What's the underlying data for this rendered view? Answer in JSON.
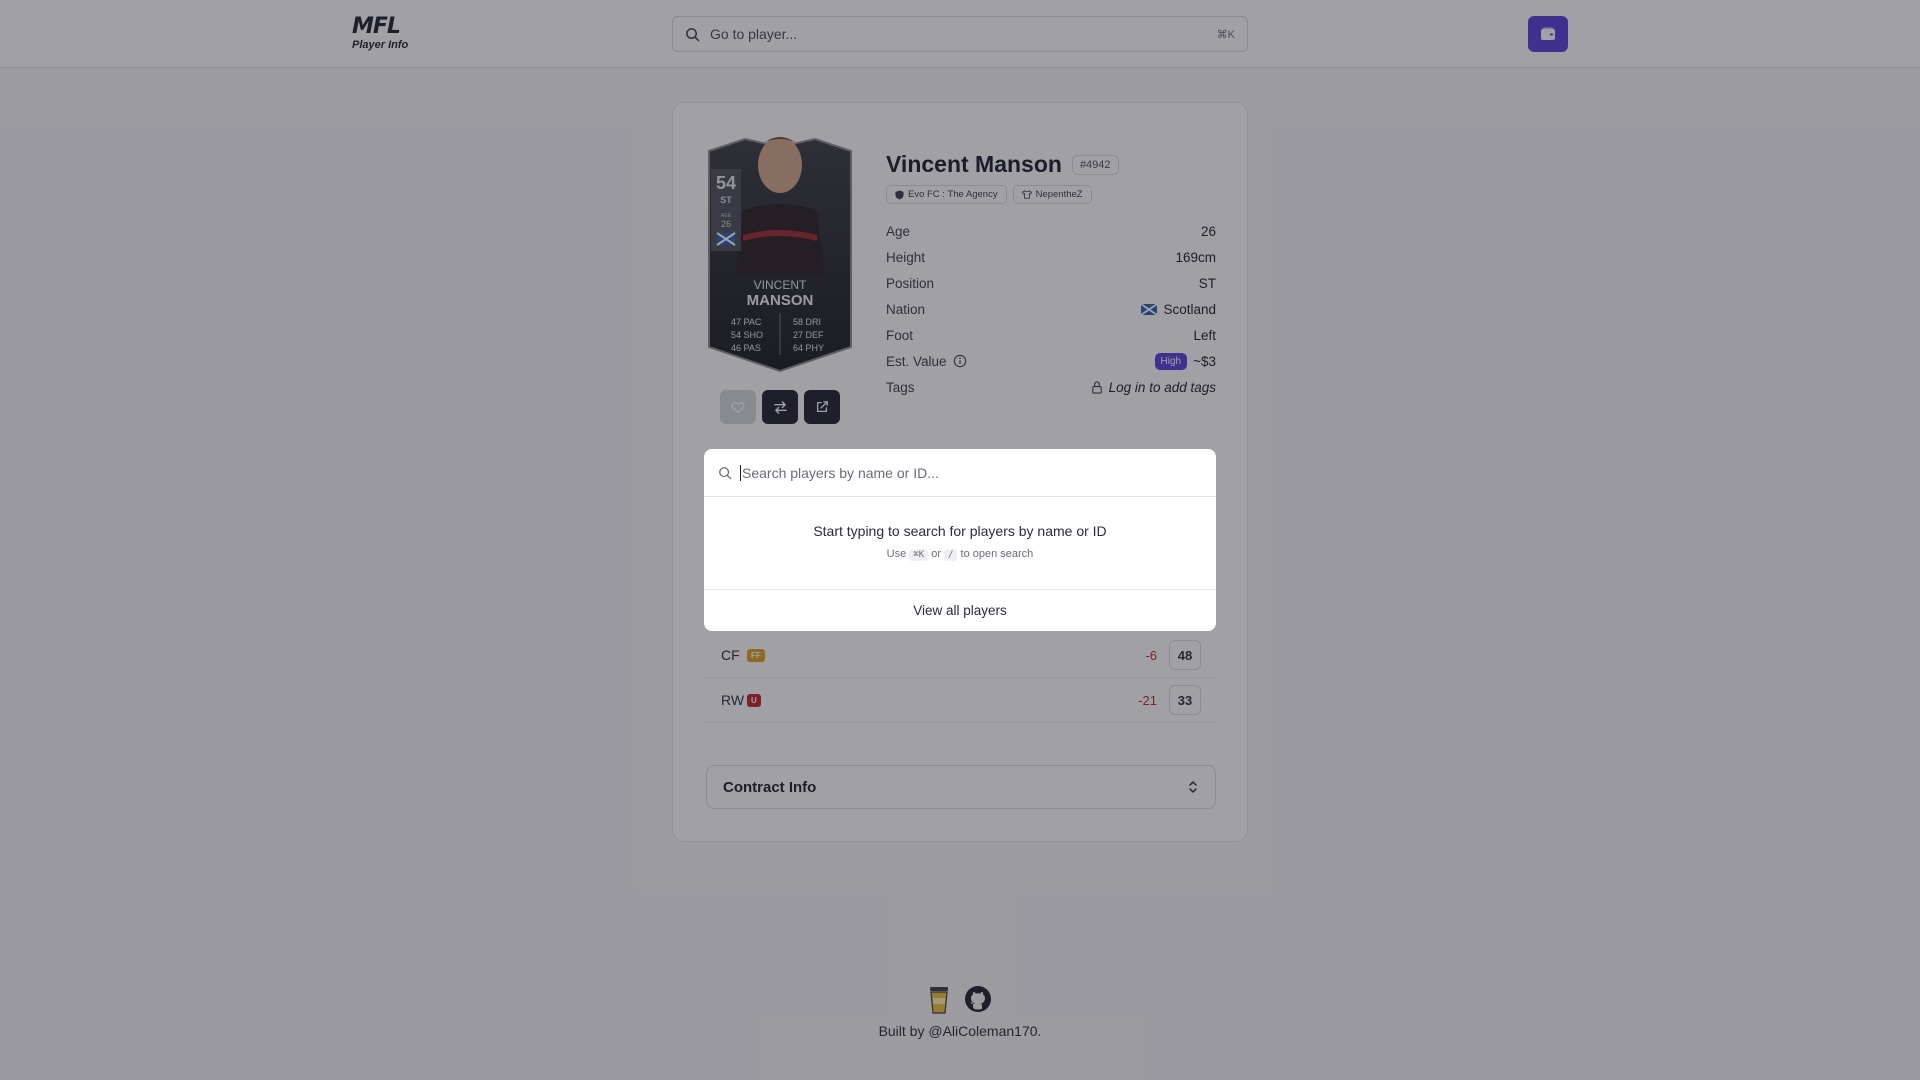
{
  "header": {
    "logo_text": "MFL",
    "logo_sub": "Player Info",
    "search_placeholder": "Go to player...",
    "search_shortcut": "⌘K"
  },
  "player": {
    "name": "Vincent Manson",
    "id": "#4942",
    "club": "Evo FC : The Agency",
    "owner": "NepentheZ",
    "attributes": [
      {
        "label": "Age",
        "value": "26"
      },
      {
        "label": "Height",
        "value": "169cm"
      },
      {
        "label": "Position",
        "value": "ST"
      },
      {
        "label": "Nation",
        "value": "Scotland"
      },
      {
        "label": "Foot",
        "value": "Left"
      },
      {
        "label": "Est. Value",
        "badge": "High",
        "value": "~$3"
      },
      {
        "label": "Tags",
        "value": "Log in to add tags"
      }
    ]
  },
  "card": {
    "overall": "54",
    "position": "ST",
    "age_label": "AGE",
    "age": "26",
    "first_name": "VINCENT",
    "last_name": "MANSON",
    "stats_left": [
      {
        "value": "47",
        "label": "PAC"
      },
      {
        "value": "54",
        "label": "SHO"
      },
      {
        "value": "46",
        "label": "PAS"
      }
    ],
    "stats_right": [
      {
        "value": "58",
        "label": "DRI"
      },
      {
        "value": "27",
        "label": "DEF"
      },
      {
        "value": "64",
        "label": "PHY"
      }
    ]
  },
  "positions": [
    {
      "pos": "CF",
      "family": "FF",
      "family_color": "#e0a21c",
      "diff": "-6",
      "rating": "48"
    },
    {
      "pos": "RW",
      "family": "U",
      "family_color": "#c0202a",
      "diff": "-21",
      "rating": "33"
    }
  ],
  "contract": {
    "title": "Contract Info"
  },
  "footer": {
    "built_by": "Built by @AliColeman170."
  },
  "dialog": {
    "placeholder": "Search players by name or ID...",
    "hint": "Start typing to search for players by name or ID",
    "sub_use": "Use",
    "key1": "⌘K",
    "sub_or": "or",
    "key2": "/",
    "sub_end": "to open search",
    "view_all": "View all players"
  },
  "colors": {
    "accent": "#5b3fd8",
    "negative": "#c02828",
    "dark": "#1f1f2e"
  }
}
